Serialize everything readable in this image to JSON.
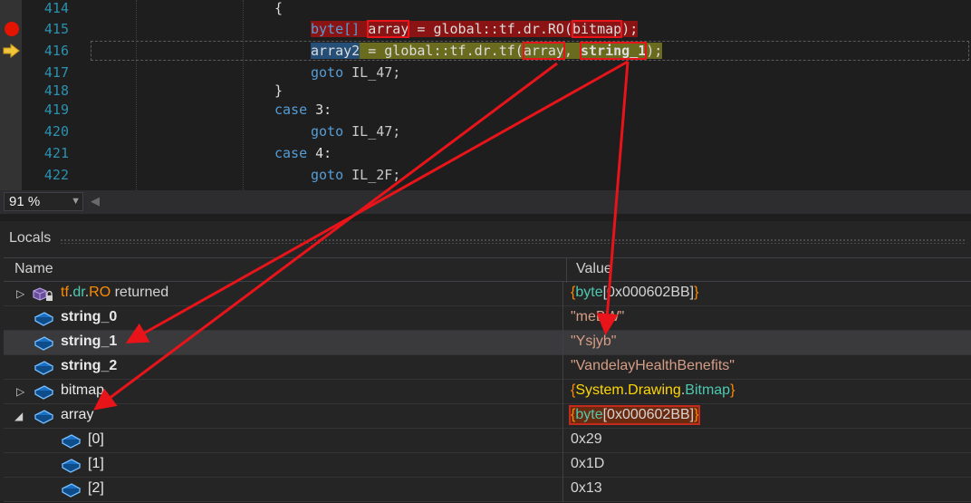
{
  "editor": {
    "lines": [
      {
        "num": "414"
      },
      {
        "num": "415"
      },
      {
        "num": "416"
      },
      {
        "num": "417"
      },
      {
        "num": "418"
      },
      {
        "num": "419"
      },
      {
        "num": "420"
      },
      {
        "num": "421"
      },
      {
        "num": "422"
      }
    ],
    "code": {
      "l414_brace": "{",
      "l415_pre": "byte[] ",
      "l415_array": "array",
      "l415_mid": " = global::tf.dr.RO(",
      "l415_bitmap": "bitmap",
      "l415_end": ");",
      "l416_array2": "array2",
      "l416_mid": " = global::tf.dr.tf(",
      "l416_arg1": "array",
      "l416_comma": ", ",
      "l416_arg2": "string_1",
      "l416_end": ");",
      "goto": "goto",
      "l417_label": " IL_47;",
      "l418_brace": "}",
      "case": "case",
      "l419_rest": " 3:",
      "l420_label": " IL_47;",
      "l421_rest": " 4:",
      "l422_label": " IL_2F;"
    }
  },
  "zoom": {
    "value": "91 %"
  },
  "locals": {
    "title": "Locals",
    "header_name": "Name",
    "header_value": "Value",
    "rows": [
      {
        "name_a": "tf",
        "name_dot1": ".",
        "name_b": "dr",
        "name_dot2": ".",
        "name_c": "RO",
        "name_d": " returned",
        "val_open": "{",
        "val_type": "byte",
        "val_rest": "[0x000602BB]",
        "val_close": "}"
      },
      {
        "name": "string_0",
        "value": "\"meBW\""
      },
      {
        "name": "string_1",
        "value": "\"Ysjyb\""
      },
      {
        "name": "string_2",
        "value": "\"VandelayHealthBenefits\""
      },
      {
        "name": "bitmap",
        "val_open": "{",
        "val_ns1": "System",
        "val_dot1": ".",
        "val_ns2": "Drawing",
        "val_dot2": ".",
        "val_type": "Bitmap",
        "val_close": "}"
      },
      {
        "name": "array",
        "val_open": "{",
        "val_type": "byte",
        "val_rest": "[0x000602BB]",
        "val_close": "}"
      },
      {
        "name": "[0]",
        "value": "0x29"
      },
      {
        "name": "[1]",
        "value": "0x1D"
      },
      {
        "name": "[2]",
        "value": "0x13"
      }
    ]
  },
  "icons": [
    "breakpoint-icon",
    "current-statement-arrow-icon",
    "field-icon",
    "method-return-icon",
    "expand-arrow-icon",
    "collapse-arrow-icon",
    "dropdown-icon"
  ],
  "colors": {
    "annotation": "#e8141a",
    "keyword": "#569cd6",
    "line_number": "#2b91af",
    "string": "#d69d85"
  }
}
